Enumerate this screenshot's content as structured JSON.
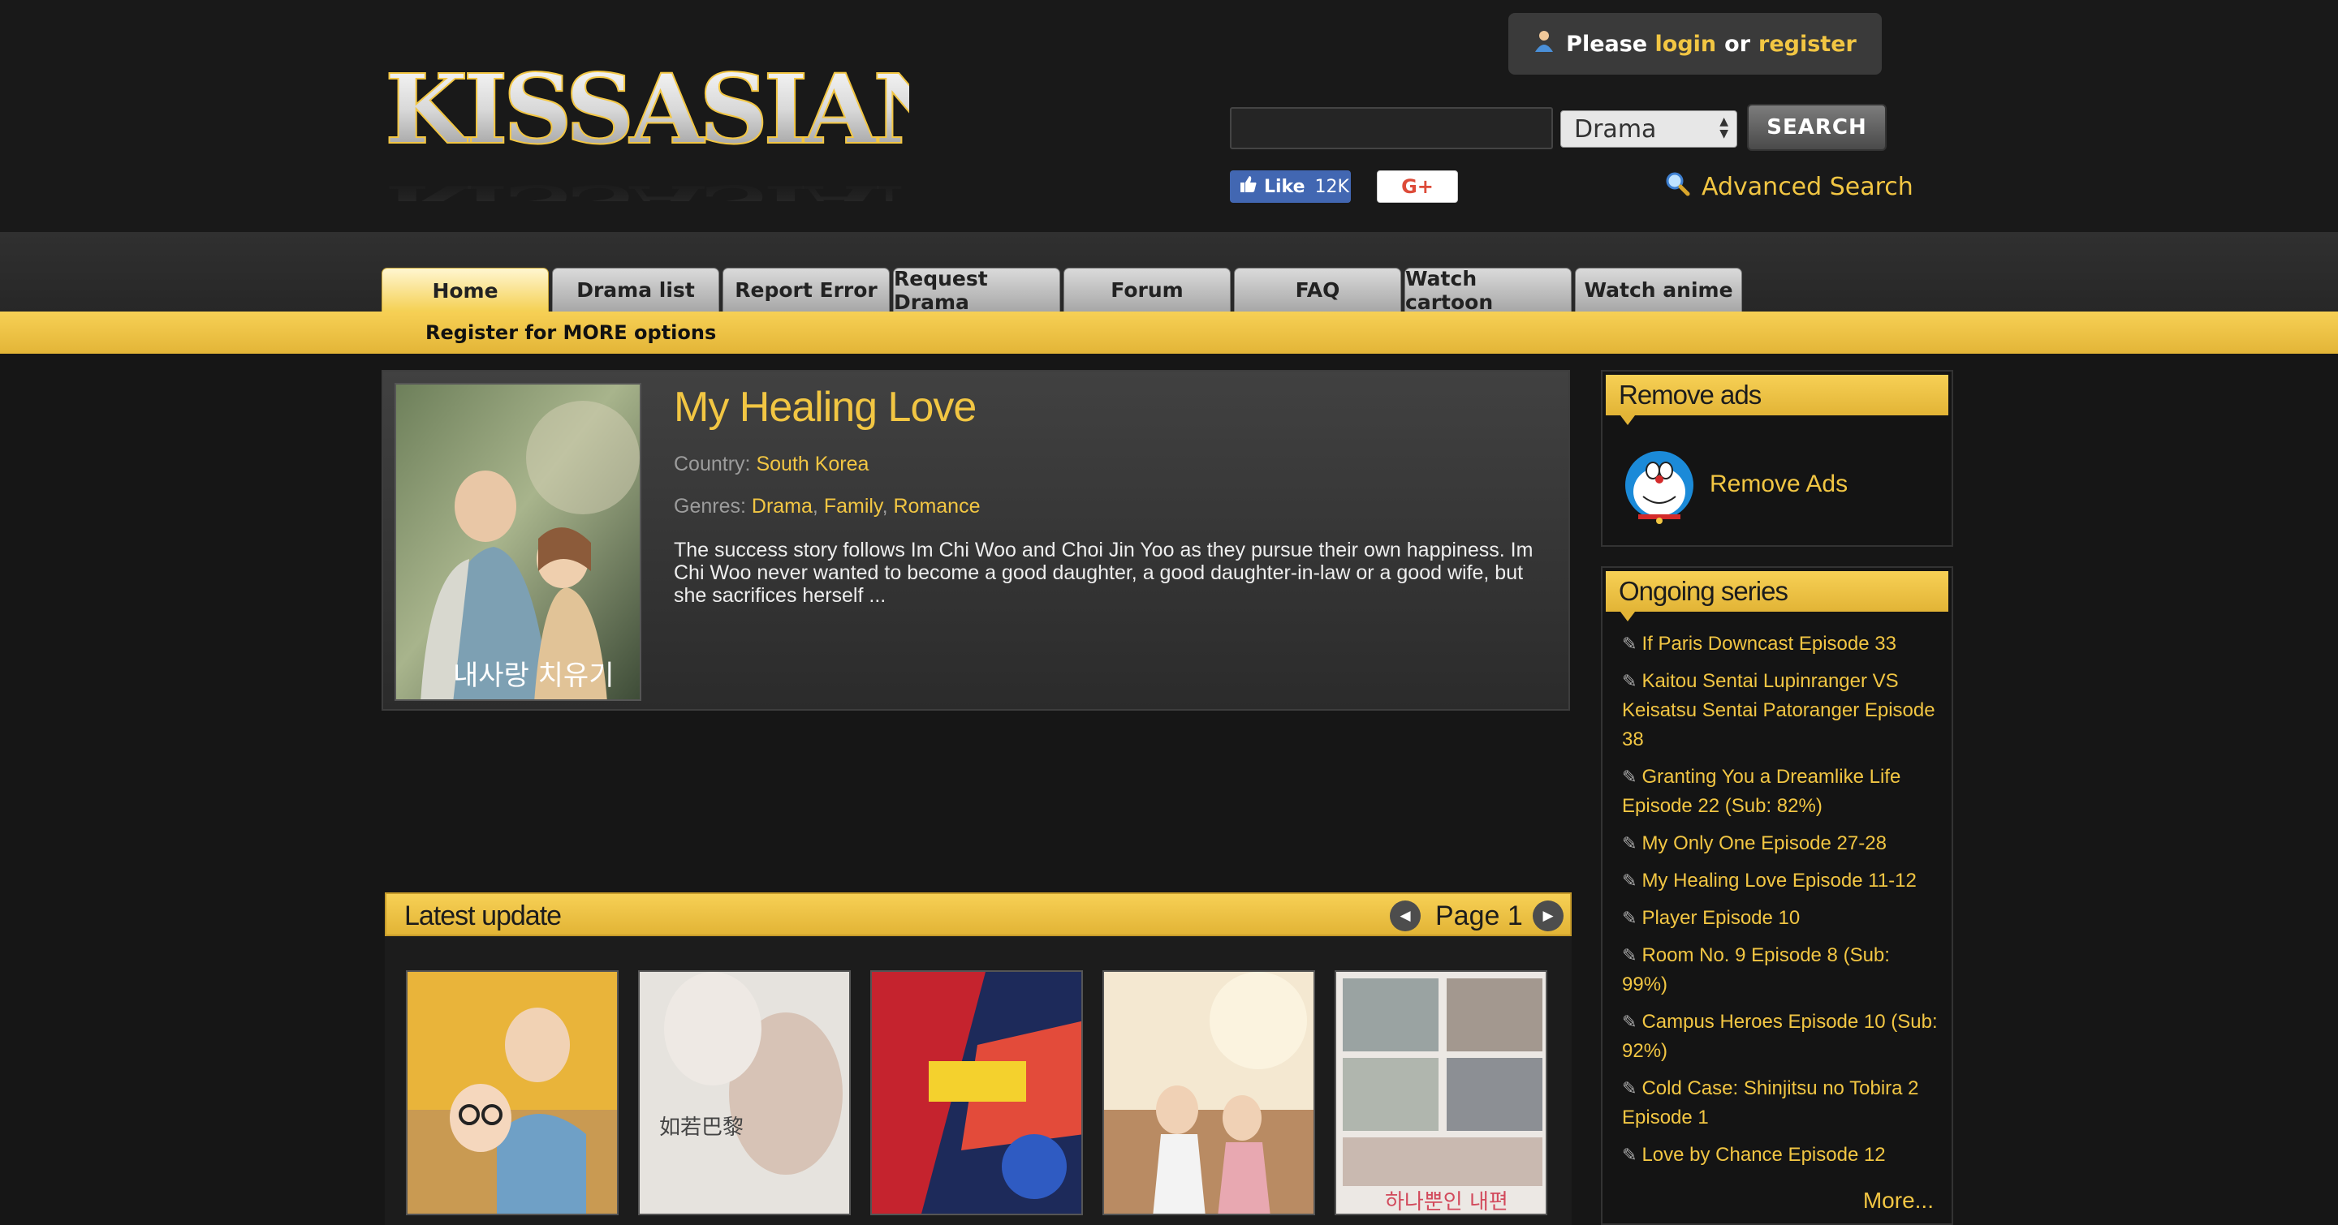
{
  "brand": {
    "logo_text": "KISSASIAN"
  },
  "header": {
    "login_prefix": "Please",
    "login_link": "login",
    "login_or": "or",
    "register_link": "register",
    "search_placeholder": "",
    "search_type": "Drama",
    "search_button": "SEARCH",
    "fb_like": "Like",
    "fb_count": "12K",
    "gplus": "G+",
    "advanced_search": "Advanced Search"
  },
  "nav": {
    "tabs": [
      "Home",
      "Drama list",
      "Report Error",
      "Request Drama",
      "Forum",
      "FAQ",
      "Watch cartoon",
      "Watch anime"
    ],
    "active": "Home",
    "subbar": "Register for MORE options"
  },
  "featured": {
    "title": "My Healing Love",
    "country_label": "Country:",
    "country": "South Korea",
    "genres_label": "Genres:",
    "genres": [
      "Drama",
      "Family",
      "Romance"
    ],
    "description": "The success story follows Im Chi Woo and Choi Jin Yoo as they pursue their own happiness. Im Chi Woo never wanted to become a good daughter, a good daughter-in-law or a good wife, but she sacrifices herself ..."
  },
  "latest": {
    "title": "Latest update",
    "page_label": "Page 1"
  },
  "sidebar": {
    "remove_ads_title": "Remove ads",
    "remove_ads_link": "Remove Ads",
    "ongoing_title": "Ongoing series",
    "ongoing": [
      "If Paris Downcast Episode 33",
      "Kaitou Sentai Lupinranger VS Keisatsu Sentai Patoranger Episode 38",
      "Granting You a Dreamlike Life Episode 22 (Sub: 82%)",
      "My Only One Episode 27-28",
      "My Healing Love Episode 11-12",
      "Player Episode 10",
      "Room No. 9 Episode 8 (Sub: 99%)",
      "Campus Heroes Episode 10 (Sub: 92%)",
      "Cold Case: Shinjitsu no Tobira 2 Episode 1",
      "Love by Chance Episode 12"
    ],
    "more": "More..."
  },
  "colors": {
    "accent": "#f2c643",
    "background": "#161616",
    "tab_active": "#f4cf4f"
  }
}
